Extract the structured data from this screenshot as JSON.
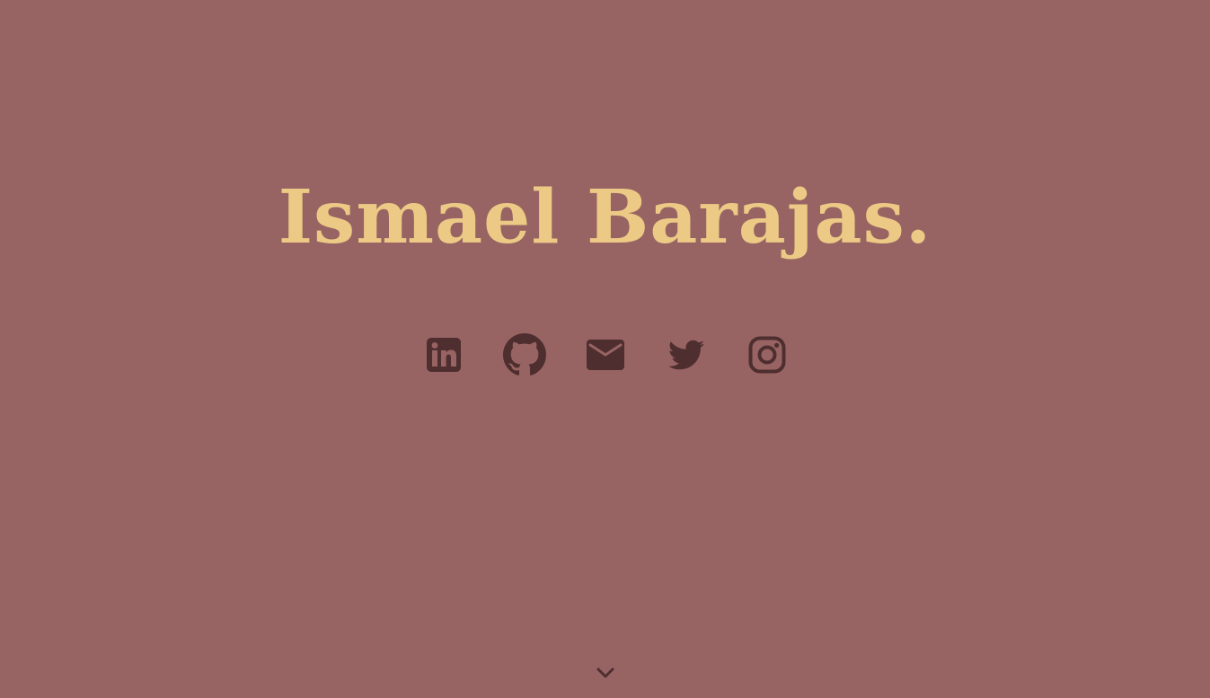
{
  "hero": {
    "title": "Ismael Barajas."
  },
  "socials": [
    {
      "icon": "linkedin-icon"
    },
    {
      "icon": "github-icon"
    },
    {
      "icon": "email-icon"
    },
    {
      "icon": "twitter-icon"
    },
    {
      "icon": "instagram-icon"
    }
  ],
  "scroll": {
    "icon": "chevron-down-icon"
  },
  "colors": {
    "background": "#986463",
    "title": "#ecca86",
    "icons": "#4e2e2f"
  }
}
